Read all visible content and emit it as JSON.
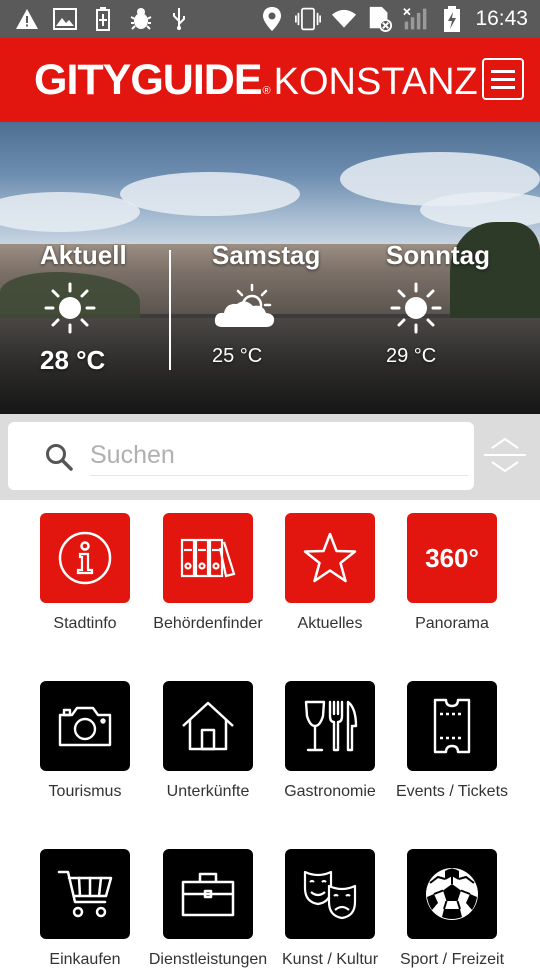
{
  "status_bar": {
    "time": "16:43",
    "left_icons": [
      "warning-icon",
      "image-icon",
      "battery-saver-icon",
      "bug-icon",
      "usb-icon"
    ],
    "right_icons": [
      "location-icon",
      "vibrate-icon",
      "wifi-icon",
      "sim-icon",
      "signal-icon",
      "battery-charging-icon"
    ]
  },
  "header": {
    "brand": "GITYGUIDE",
    "registered_mark": "®",
    "city": "KONSTANZ",
    "menu_icon": "hamburger-menu-icon",
    "background_color": "#e2160f"
  },
  "weather": {
    "days": [
      {
        "label": "Aktuell",
        "icon": "sun-icon",
        "temp": "28 °C"
      },
      {
        "label": "Samstag",
        "icon": "partly-cloudy-icon",
        "temp": "25 °C"
      },
      {
        "label": "Sonntag",
        "icon": "sun-icon",
        "temp": "29 °C"
      }
    ]
  },
  "search": {
    "placeholder": "Suchen",
    "value": "",
    "icon": "search-icon",
    "toggle_icon": "collapse-expand-icon"
  },
  "tiles": [
    {
      "label": "Stadtinfo",
      "icon": "info-icon",
      "color": "red"
    },
    {
      "label": "Behördenfinder",
      "icon": "binders-icon",
      "color": "red"
    },
    {
      "label": "Aktuelles",
      "icon": "star-icon",
      "color": "red"
    },
    {
      "label": "Panorama",
      "icon": "panorama-360-icon",
      "color": "red",
      "icon_text": "360°"
    },
    {
      "label": "Tourismus",
      "icon": "camera-icon",
      "color": "black"
    },
    {
      "label": "Unterkünfte",
      "icon": "house-icon",
      "color": "black"
    },
    {
      "label": "Gastronomie",
      "icon": "wine-cutlery-icon",
      "color": "black"
    },
    {
      "label": "Events / Tickets",
      "icon": "ticket-icon",
      "color": "black"
    },
    {
      "label": "Einkaufen",
      "icon": "shopping-cart-icon",
      "color": "black"
    },
    {
      "label": "Dienstleistungen",
      "icon": "briefcase-icon",
      "color": "black"
    },
    {
      "label": "Kunst / Kultur",
      "icon": "theater-masks-icon",
      "color": "black"
    },
    {
      "label": "Sport / Freizeit",
      "icon": "soccer-ball-icon",
      "color": "black"
    }
  ],
  "colors": {
    "accent": "#e2160f",
    "tile_dark": "#000000",
    "status_bar": "#5a5a5a"
  }
}
